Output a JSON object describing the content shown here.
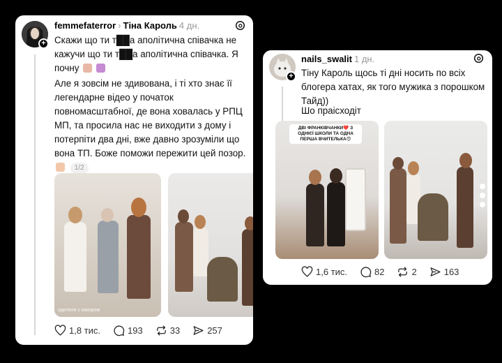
{
  "post_left": {
    "username": "femmefaterror",
    "reply_to": "Тіна Кароль",
    "time": "4 дн.",
    "text1": "Скажи що ти т██а аполітична співачка не кажучи що ти т██а аполітична співачка. Я почну",
    "text2": "Але я зовсім не здивована, і ті хто знає її легендарне відео у початок повномасштабної, де вона ховалась у РПЦ МП, та просила нас не виходити з дому і потерпіти два дні, вже давно зрозуміли що вона ТП. Боже поможи пережити цей позор.",
    "page_indicator": "1/2",
    "media_caption": "одители с юмором",
    "likes": "1,8 тис.",
    "comments": "193",
    "reposts": "33",
    "shares": "257"
  },
  "post_right": {
    "username": "nails_swalit",
    "time": "1 дн.",
    "text1": "Тіну Кароль щось ті дні носить по всіх блогера хатах, як того мужика з порошком Тайд))",
    "text2": "Шо праісходіт",
    "overlay_text": "ДВІ ФРАНКІВЧАНКИ❤️ З ОДНІЄЇ ШКОЛИ ТА ОДНА ПЕРША ВЧИТЕЛЬКА😍",
    "likes": "1,6 тис.",
    "comments": "82",
    "reposts": "2",
    "shares": "163"
  },
  "colors": {
    "background": "#000000",
    "card": "#ffffff",
    "muted": "#999999"
  },
  "icons": [
    "threads-logo-icon",
    "heart-icon",
    "comment-icon",
    "repost-icon",
    "share-icon",
    "follow-plus-icon"
  ]
}
